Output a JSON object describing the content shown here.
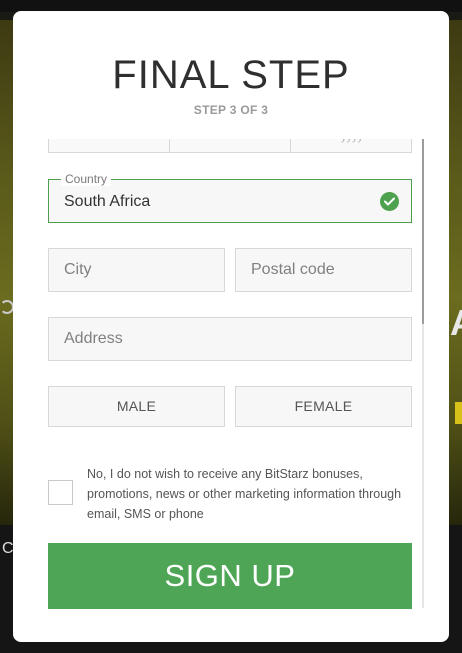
{
  "modal": {
    "title": "FINAL STEP",
    "step": "STEP 3 OF 3"
  },
  "form": {
    "dob_year_placeholder": "yyyy",
    "country": {
      "label": "Country",
      "value": "South Africa",
      "valid": true
    },
    "city": {
      "placeholder": "City"
    },
    "postal_code": {
      "placeholder": "Postal code"
    },
    "address": {
      "placeholder": "Address"
    },
    "gender": {
      "male": "MALE",
      "female": "FEMALE"
    },
    "consent_text": "No, I do not wish to receive any BitStarz bonuses, promotions, news or other marketing information through email, SMS or phone",
    "consent_checked": false,
    "submit_label": "SIGN UP"
  },
  "background": {
    "left_fragment": "C",
    "right_fragment": "A"
  },
  "colors": {
    "accent_green": "#4ea556",
    "valid_green": "#4e9e4e",
    "title_text": "#2f2f2f"
  }
}
